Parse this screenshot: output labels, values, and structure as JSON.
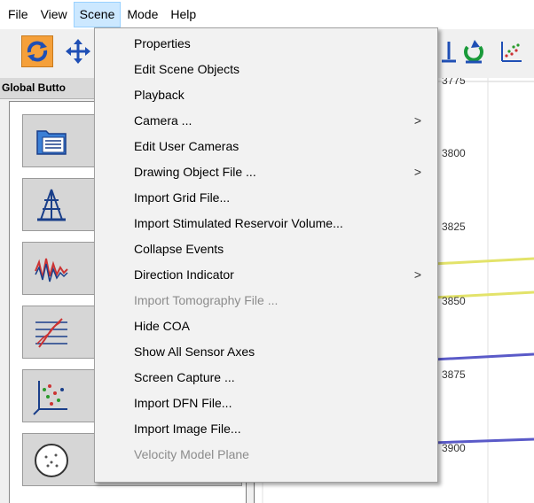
{
  "menubar": {
    "items": [
      "File",
      "View",
      "Scene",
      "Mode",
      "Help"
    ],
    "active": "Scene"
  },
  "toolbar": {
    "buttons": [
      {
        "icon": "rotate-icon",
        "selected": true
      },
      {
        "icon": "move-icon",
        "selected": false
      },
      {
        "icon": "well-view-icon",
        "selected": false
      },
      {
        "icon": "refresh-icon",
        "selected": false
      },
      {
        "icon": "points-icon",
        "selected": false
      }
    ]
  },
  "panel": {
    "header": "Global Butto",
    "buttons": [
      "folder-icon",
      "derrick-icon",
      "waveform-icon",
      "traces-icon",
      "scatter-icon",
      "stereonet-icon"
    ]
  },
  "plot": {
    "depth_labels": [
      "3775",
      "3800",
      "3825",
      "3850",
      "3875",
      "3900"
    ],
    "line_colors": {
      "yellow": "#e3e36a",
      "blue": "#5a5ac8"
    }
  },
  "scene_menu": {
    "items": [
      {
        "label": "Properties",
        "submenu": false,
        "enabled": true
      },
      {
        "label": "Edit Scene Objects",
        "submenu": false,
        "enabled": true
      },
      {
        "label": "Playback",
        "submenu": false,
        "enabled": true
      },
      {
        "label": "Camera ...",
        "submenu": true,
        "enabled": true
      },
      {
        "label": "Edit User Cameras",
        "submenu": false,
        "enabled": true
      },
      {
        "label": "Drawing Object File ...",
        "submenu": true,
        "enabled": true
      },
      {
        "label": "Import Grid File...",
        "submenu": false,
        "enabled": true
      },
      {
        "label": "Import Stimulated Reservoir Volume...",
        "submenu": false,
        "enabled": true
      },
      {
        "label": "Collapse Events",
        "submenu": false,
        "enabled": true
      },
      {
        "label": "Direction Indicator",
        "submenu": true,
        "enabled": true
      },
      {
        "label": "Import Tomography File ...",
        "submenu": false,
        "enabled": false
      },
      {
        "label": "Hide COA",
        "submenu": false,
        "enabled": true
      },
      {
        "label": "Show All Sensor Axes",
        "submenu": false,
        "enabled": true
      },
      {
        "label": "Screen Capture ...",
        "submenu": false,
        "enabled": true
      },
      {
        "label": "Import DFN File...",
        "submenu": false,
        "enabled": true
      },
      {
        "label": "Import Image File...",
        "submenu": false,
        "enabled": true
      },
      {
        "label": "Velocity Model Plane",
        "submenu": false,
        "enabled": false
      }
    ],
    "submenu_arrow": ">"
  }
}
